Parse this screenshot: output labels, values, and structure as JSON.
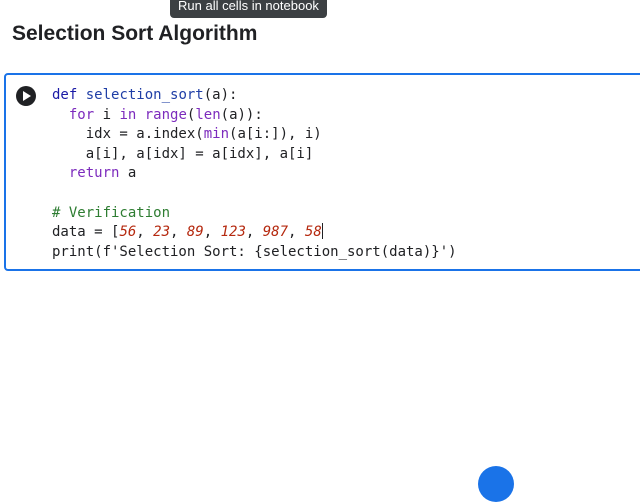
{
  "tooltip": "Run all cells in notebook",
  "page_title": "Selection Sort Algorithm",
  "code": {
    "l1_kw": "def",
    "l1_fn": "selection_sort",
    "l1_rest": "(a):",
    "l2_indent": "  ",
    "l2_for": "for",
    "l2_i": " i ",
    "l2_in": "in",
    "l2_range": "range",
    "l2_rest1": "(",
    "l2_len": "len",
    "l2_rest2": "(a)):",
    "l3_a": "    idx = a.index(",
    "l3_min": "min",
    "l3_b": "(a[i:]), i)",
    "l4": "    a[i], a[idx] = a[idx], a[i]",
    "l5_indent": "  ",
    "l5_return": "return",
    "l5_rest": " a",
    "l7_comment": "# Verification",
    "l8_a": "data = [",
    "l8_nums": [
      "56",
      "23",
      "89",
      "123",
      "987",
      "58"
    ],
    "l9_a": "print(f'Selection Sort: {selection_sort(data)}')"
  }
}
